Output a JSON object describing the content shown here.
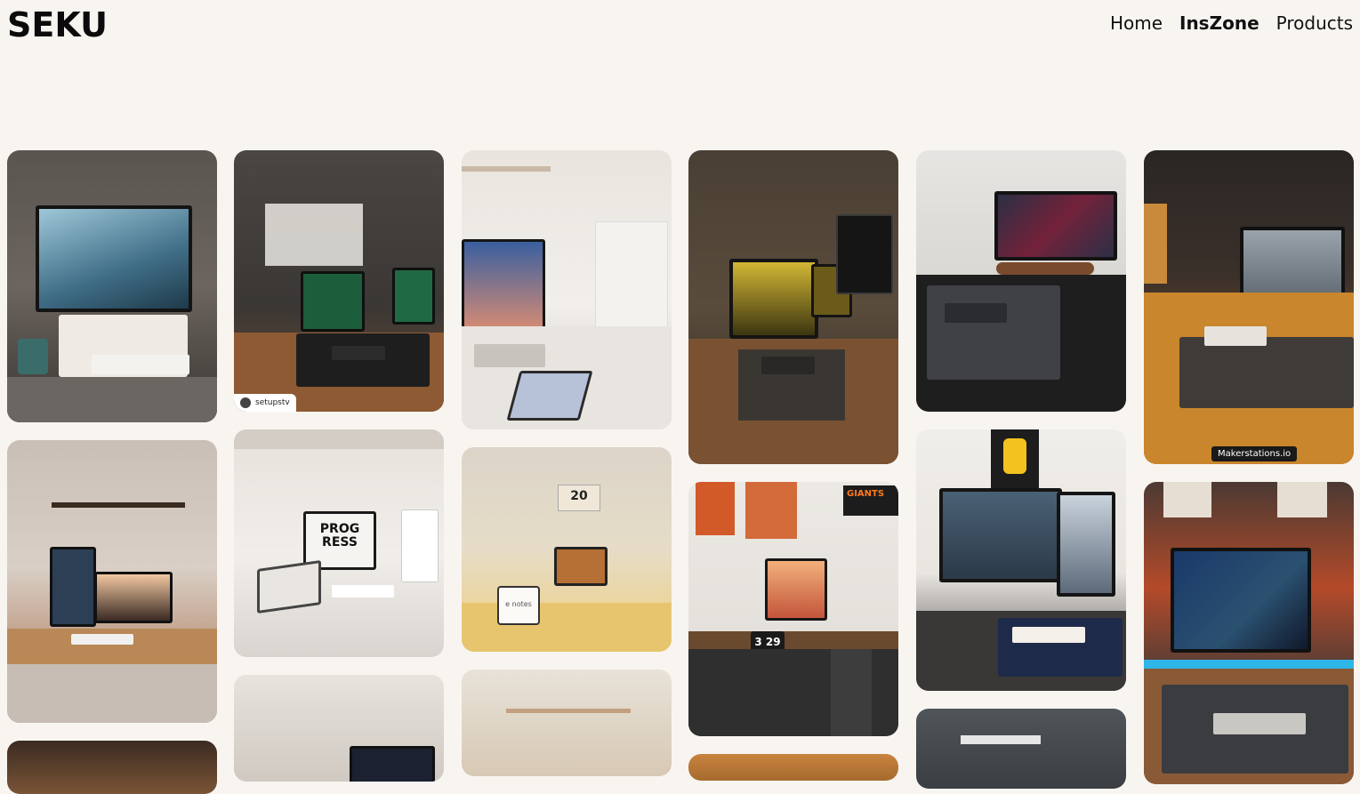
{
  "brand": {
    "logo": "SEKU"
  },
  "nav": {
    "items": [
      "Home",
      "InsZone",
      "Products"
    ],
    "active": "InsZone"
  },
  "gallery": {
    "credits": {
      "setups": "setupstv",
      "maker": "Makerstations.io"
    },
    "image_labels": {
      "progress_text": "PROG RESS",
      "clock_text": "20",
      "notes_text": "e notes",
      "flip_clock": "3 29",
      "giants_text": "GIANTS"
    }
  }
}
